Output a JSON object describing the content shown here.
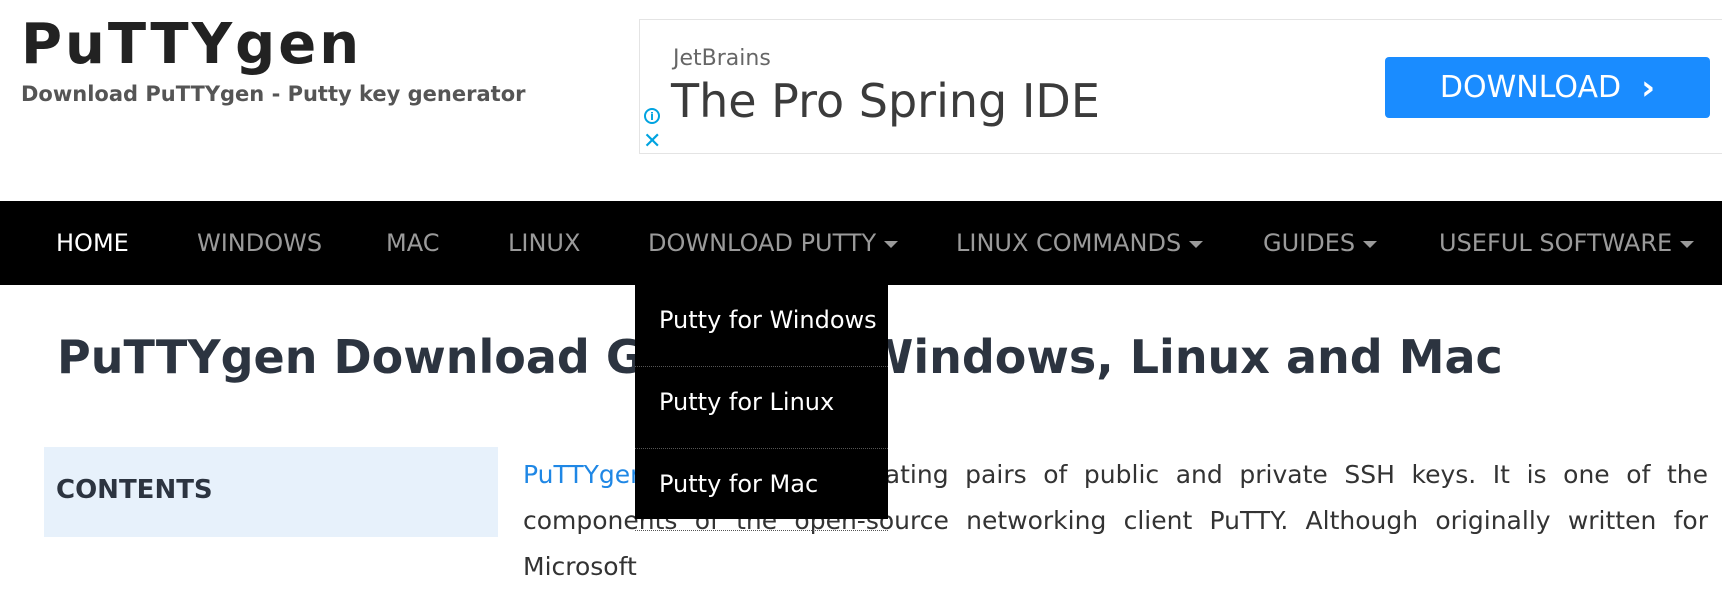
{
  "header": {
    "title": "PuTTYgen",
    "subtitle": "Download PuTTYgen - Putty key generator"
  },
  "ad": {
    "brand": "JetBrains",
    "headline": "The Pro Spring IDE",
    "button_label": "DOWNLOAD",
    "info_icon_label": "i",
    "close_icon_label": "✕",
    "chevron_label": "›",
    "button_color": "#1a8cff"
  },
  "nav": {
    "items": [
      {
        "label": "HOME",
        "active": true
      },
      {
        "label": "WINDOWS"
      },
      {
        "label": "MAC"
      },
      {
        "label": "LINUX"
      },
      {
        "label": "DOWNLOAD PUTTY",
        "has_dropdown": true
      },
      {
        "label": "LINUX COMMANDS",
        "has_dropdown": true
      },
      {
        "label": "GUIDES",
        "has_dropdown": true
      },
      {
        "label": "USEFUL SOFTWARE",
        "has_dropdown": true
      }
    ],
    "open_dropdown": {
      "parent": "DOWNLOAD PUTTY",
      "items": [
        "Putty for Windows",
        "Putty for Linux",
        "Putty for Mac"
      ]
    }
  },
  "main": {
    "page_title": "PuTTYgen Download Guide for Windows, Linux and Mac",
    "contents_heading": "CONTENTS",
    "intro_link": "PuTTYgen",
    "intro_text": " is a tool for creating pairs of public and private SSH keys. It is one of the components of the open-source networking client PuTTY. Although originally written for Microsoft"
  },
  "colors": {
    "nav_bg": "#000000",
    "link": "#1f87e5",
    "contents_bg": "#e7f1fb"
  }
}
